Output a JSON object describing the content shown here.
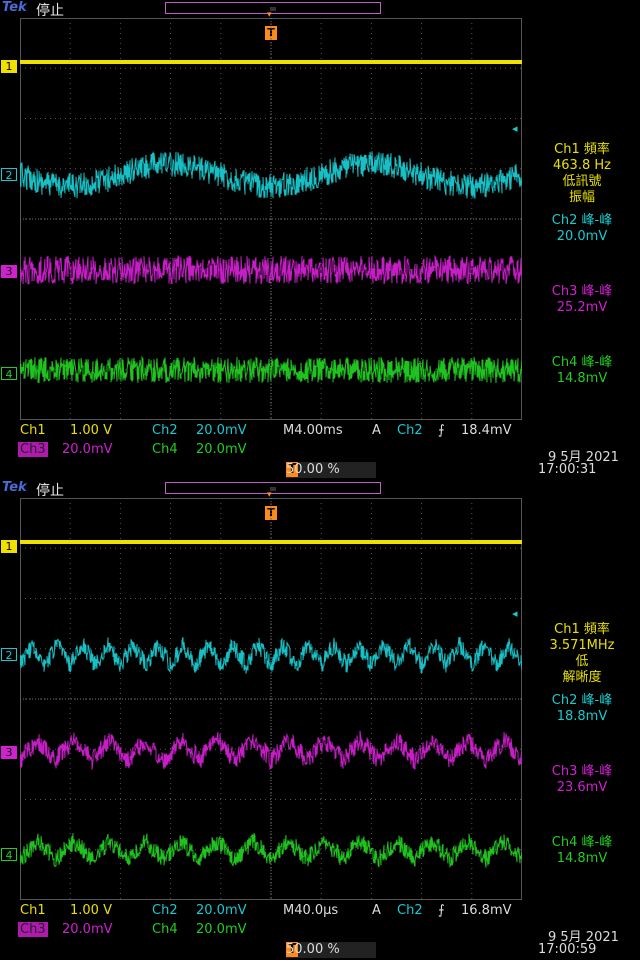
{
  "panels": [
    {
      "brand": "Tek",
      "state": "停止",
      "trigger_marker": "T",
      "measurements": {
        "ch1_label": "Ch1 頻率",
        "ch1_value": "463.8 Hz",
        "ch1_note1": "低訊號",
        "ch1_note2": "振幅",
        "ch2_label": "Ch2 峰-峰",
        "ch2_value": "20.0mV",
        "ch3_label": "Ch3 峰-峰",
        "ch3_value": "25.2mV",
        "ch4_label": "Ch4 峰-峰",
        "ch4_value": "14.8mV"
      },
      "status": {
        "ch1": "Ch1",
        "ch1_scale": "1.00 V",
        "ch2": "Ch2",
        "ch2_scale": "20.0mV",
        "timebase": "M4.00ms",
        "trig_mode": "A",
        "trig_src": "Ch2",
        "trig_slope": "⨍",
        "trig_level": "18.4mV",
        "ch3": "Ch3",
        "ch3_scale": "20.0mV",
        "ch4": "Ch4",
        "ch4_scale": "20.0mV",
        "trig_pos": "50.00 %",
        "date": "9 5月  2021",
        "time": "17:00:31"
      },
      "wave": {
        "ch2_cycles": 2.5,
        "ch3_cycles": 0,
        "ch4_cycles": 0
      }
    },
    {
      "brand": "Tek",
      "state": "停止",
      "trigger_marker": "T",
      "measurements": {
        "ch1_label": "Ch1 頻率",
        "ch1_value": "3.571MHz",
        "ch1_note1": "低",
        "ch1_note2": "解晰度",
        "ch2_label": "Ch2 峰-峰",
        "ch2_value": "18.8mV",
        "ch3_label": "Ch3 峰-峰",
        "ch3_value": "23.6mV",
        "ch4_label": "Ch4 峰-峰",
        "ch4_value": "14.8mV"
      },
      "status": {
        "ch1": "Ch1",
        "ch1_scale": "1.00 V",
        "ch2": "Ch2",
        "ch2_scale": "20.0mV",
        "timebase": "M40.0µs",
        "trig_mode": "A",
        "trig_src": "Ch2",
        "trig_slope": "⨍",
        "trig_level": "16.8mV",
        "ch3": "Ch3",
        "ch3_scale": "20.0mV",
        "ch4": "Ch4",
        "ch4_scale": "20.0mV",
        "trig_pos": "50.00 %",
        "date": "9 5月  2021",
        "time": "17:00:59"
      },
      "wave": {
        "ch2_cycles": 20,
        "ch3_cycles": 14,
        "ch4_cycles": 14
      }
    }
  ],
  "channel_markers": [
    "1",
    "2",
    "3",
    "4"
  ],
  "colors": {
    "ch1": "#f0e000",
    "ch2": "#19c9cf",
    "ch3": "#d020d0",
    "ch4": "#22cc22",
    "trigger": "#ff8a1a"
  }
}
